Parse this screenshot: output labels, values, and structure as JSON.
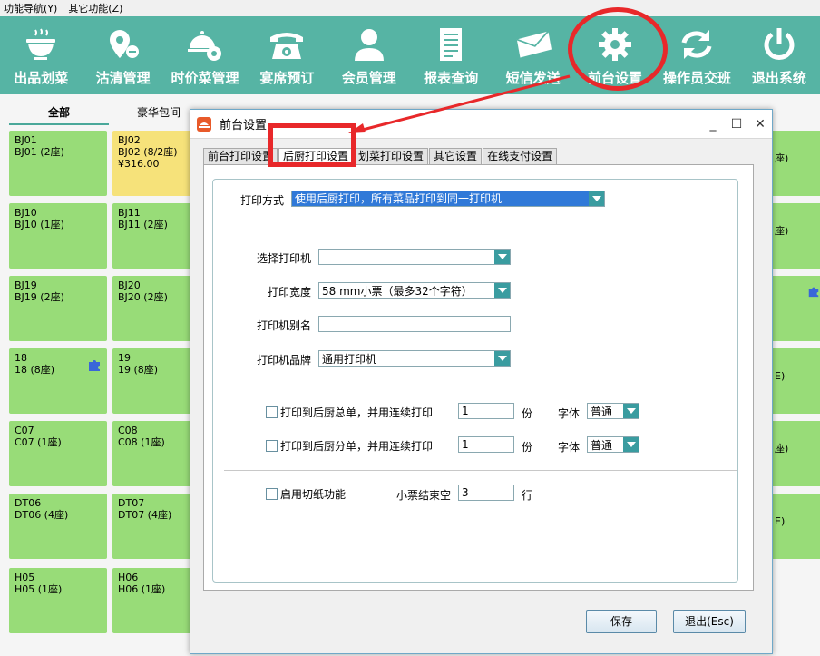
{
  "menu": {
    "items": [
      "功能导航(Y)",
      "其它功能(Z)"
    ]
  },
  "toolbar": {
    "items": [
      {
        "label": "出品划菜",
        "icon": "bowl-icon"
      },
      {
        "label": "沽清管理",
        "icon": "location-pin-icon"
      },
      {
        "label": "时价菜管理",
        "icon": "cloche-gear-icon"
      },
      {
        "label": "宴席预订",
        "icon": "telephone-icon"
      },
      {
        "label": "会员管理",
        "icon": "user-icon"
      },
      {
        "label": "报表查询",
        "icon": "report-icon"
      },
      {
        "label": "短信发送",
        "icon": "envelope-icon"
      },
      {
        "label": "前台设置",
        "icon": "gear-icon"
      },
      {
        "label": "操作员交班",
        "icon": "refresh-icon"
      },
      {
        "label": "退出系统",
        "icon": "power-icon"
      }
    ]
  },
  "categories": [
    "全部",
    "豪华包间"
  ],
  "tables": [
    {
      "code": "BJ01",
      "name": "BJ01 (2座)",
      "amount": ""
    },
    {
      "code": "BJ02",
      "name": "BJ02 (8/2座)",
      "amount": "¥316.00"
    },
    {
      "code": "BJ10",
      "name": "BJ10 (1座)",
      "amount": ""
    },
    {
      "code": "BJ11",
      "name": "BJ11 (2座)",
      "amount": ""
    },
    {
      "code": "BJ19",
      "name": "BJ19 (2座)",
      "amount": ""
    },
    {
      "code": "BJ20",
      "name": "BJ20 (2座)",
      "amount": ""
    },
    {
      "code": "18",
      "name": "18 (8座)",
      "amount": ""
    },
    {
      "code": "19",
      "name": "19 (8座)",
      "amount": ""
    },
    {
      "code": "C07",
      "name": "C07 (1座)",
      "amount": ""
    },
    {
      "code": "C08",
      "name": "C08 (1座)",
      "amount": ""
    },
    {
      "code": "DT06",
      "name": "DT06 (4座)",
      "amount": ""
    },
    {
      "code": "DT07",
      "name": "DT07 (4座)",
      "amount": ""
    },
    {
      "code": "H05",
      "name": "H05 (1座)",
      "amount": ""
    },
    {
      "code": "H06",
      "name": "H06 (1座)",
      "amount": ""
    }
  ],
  "side_tiles": [
    "座)",
    "座)",
    "",
    "E)",
    "座)",
    "E)"
  ],
  "dialog": {
    "title": "前台设置",
    "tabs": [
      "前台打印设置",
      "后厨打印设置",
      "划菜打印设置",
      "其它设置",
      "在线支付设置"
    ],
    "active_tab": 1,
    "print_mode_label": "打印方式",
    "print_mode_value": "使用后厨打印，所有菜品打印到同一打印机",
    "printer_label": "选择打印机",
    "printer_value": "",
    "width_label": "打印宽度",
    "width_value": "58 mm小票（最多32个字符）",
    "alias_label": "打印机别名",
    "alias_value": "",
    "brand_label": "打印机品牌",
    "brand_value": "通用打印机",
    "check_total_label": "打印到后厨总单，并用连续打印",
    "check_total_copies": "1",
    "check_split_label": "打印到后厨分单，并用连续打印",
    "check_split_copies": "1",
    "copies_unit": "份",
    "font_label": "字体",
    "font_value": "普通",
    "cut_label": "启用切纸功能",
    "blank_label": "小票结束空",
    "blank_value": "3",
    "blank_unit": "行",
    "save_label": "保存",
    "exit_label": "退出(Esc)"
  },
  "colors": {
    "toolbar": "#56b4a4",
    "tile_free": "#98dc78",
    "tile_busy": "#f6e27a",
    "annotation": "#e8282a",
    "dropdown": "#3a9ca0"
  }
}
